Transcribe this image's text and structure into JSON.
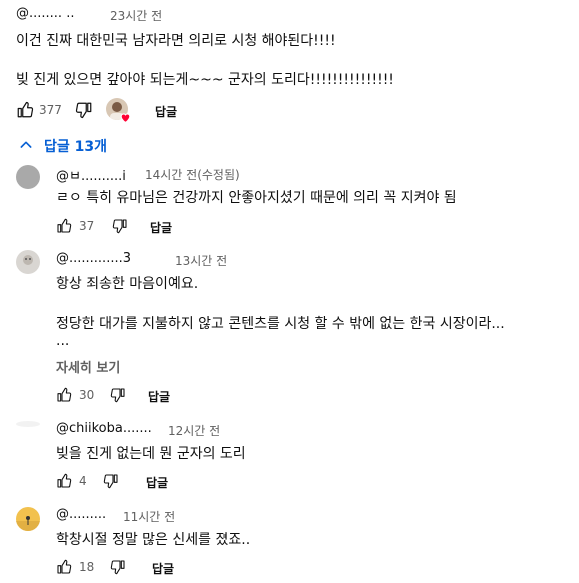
{
  "top_comment": {
    "handle": "@........ ..",
    "time": "23시간 전",
    "line1": "이건 진짜 대한민국 남자라면   의리로  시청 해야된다!!!!",
    "line2": "빚 진게 있으면 갚아야 되는게~~~   군자의  도리다!!!!!!!!!!!!!!!",
    "likes": "377",
    "reply_label": "답글"
  },
  "replies_toggle": {
    "label": "답글 13개",
    "accent": "#065fd4"
  },
  "replies": [
    {
      "handle": "@ㅂ..........i",
      "time": "14시간 전(수정됨)",
      "text": "ㄹㅇ 특히 유마님은 건강까지 안좋아지셨기 때문에 의리 꼭 지켜야 됨",
      "likes": "37",
      "reply_label": "답글"
    },
    {
      "handle": "@.............3",
      "time": "13시간 전",
      "text_line1": "항상 죄송한 마음이예요.",
      "text_line2": "정당한 대가를 지불하지 않고 콘텐츠를 시청 할 수 밖에 없는 한국 시장이라...",
      "text_line3": "...",
      "more_label": "자세히 보기",
      "likes": "30",
      "reply_label": "답글"
    },
    {
      "handle": "@chiikoba.......",
      "time": "12시간 전",
      "text": "빚을 진게 없는데 뭔 군자의 도리",
      "likes": "4",
      "reply_label": "답글"
    },
    {
      "handle": "@.........",
      "time": "11시간 전",
      "text": "학창시절 정말 많은 신세를 졌죠..",
      "likes": "18",
      "reply_label": "답글"
    }
  ],
  "icons": {
    "like": "thumbs-up-icon",
    "dislike": "thumbs-down-icon",
    "toggle": "chevron-up-icon",
    "creator_heart": "heart-icon"
  },
  "colors": {
    "heart": "#ff0033",
    "accent": "#065fd4"
  }
}
